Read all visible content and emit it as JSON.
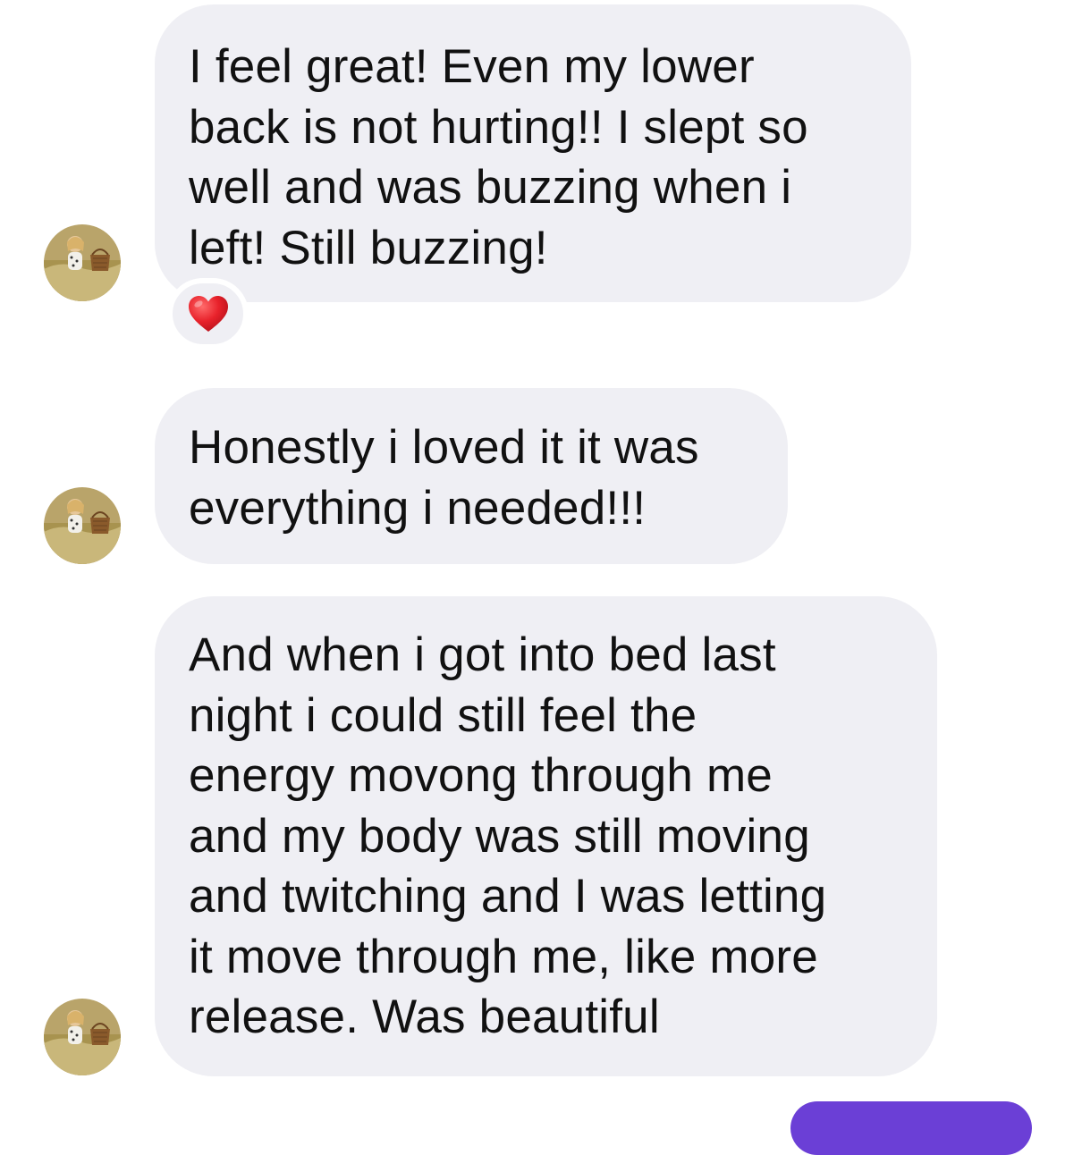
{
  "conversation": {
    "messages": [
      {
        "sender": "incoming",
        "text": "I feel great! Even my lower\nback is not hurting!! I slept so\nwell and was buzzing when i\nleft! Still buzzing!",
        "reaction": "heart-icon"
      },
      {
        "sender": "incoming",
        "text": "Honestly i loved it it was\neverything i needed!!!"
      },
      {
        "sender": "incoming",
        "text": "And when i got into bed last\nnight i could still feel the\nenergy movong through me\nand my body was still moving\nand twitching and I was letting\nit move through me, like more\nrelease. Was beautiful"
      }
    ]
  },
  "colors": {
    "incoming_bubble": "#efeff4",
    "outgoing_bubble": "#6b3fd6",
    "reaction_heart": "#e8222b",
    "text": "#111111"
  }
}
